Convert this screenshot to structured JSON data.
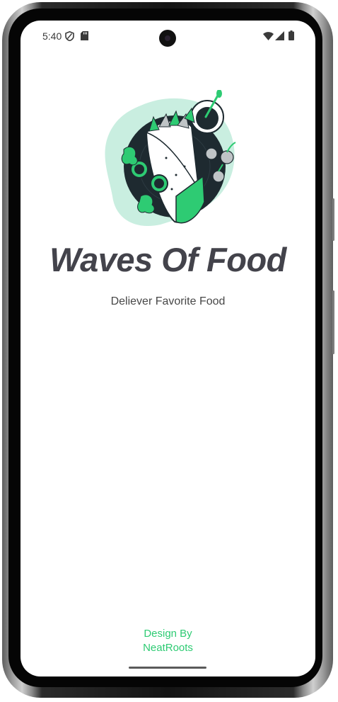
{
  "status_bar": {
    "time": "5:40",
    "icons": [
      "shield-icon",
      "sd-card-icon",
      "wifi-icon",
      "signal-icon",
      "battery-icon"
    ]
  },
  "splash": {
    "title": "Waves Of Food",
    "tagline": "Deliever Favorite Food",
    "illustration": "food-plate-illustration"
  },
  "footer": {
    "line1": "Design By",
    "line2": "NeatRoots"
  },
  "colors": {
    "accent_green": "#2ecb73",
    "title_text": "#43434b",
    "blob_mint": "#c9eee0",
    "plate_dark": "#1e2a30"
  }
}
